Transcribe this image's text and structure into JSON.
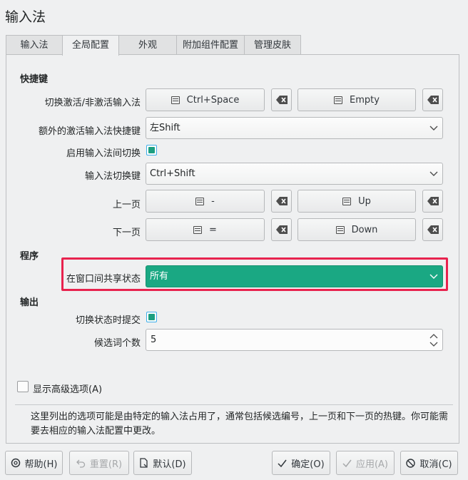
{
  "window": {
    "title": "输入法"
  },
  "tabs": [
    "输入法",
    "全局配置",
    "外观",
    "附加组件配置",
    "管理皮肤"
  ],
  "sections": {
    "hotkeys": "快捷键",
    "program": "程序",
    "output": "输出"
  },
  "hotkeys": {
    "toggle": {
      "label": "切换激活/非激活输入法",
      "key1": "Ctrl+Space",
      "key2": "Empty"
    },
    "extra": {
      "label": "额外的激活输入法快捷键",
      "value": "左Shift"
    },
    "enable_switch": {
      "label": "启用输入法间切换"
    },
    "switch_key": {
      "label": "输入法切换键",
      "value": "Ctrl+Shift"
    },
    "prev_page": {
      "label": "上一页",
      "key1": "-",
      "key2": "Up"
    },
    "next_page": {
      "label": "下一页",
      "key1": "=",
      "key2": "Down"
    }
  },
  "program": {
    "share_state": {
      "label": "在窗口间共享状态",
      "value": "所有"
    }
  },
  "output": {
    "commit_on_switch": {
      "label": "切换状态时提交"
    },
    "candidate_count": {
      "label": "候选词个数",
      "value": "5"
    }
  },
  "advanced": {
    "label": "显示高级选项(A)"
  },
  "description": "这里列出的选项可能是由特定的输入法占用了，通常包括候选编号，上一页和下一页的热键。你可能需要去相应的输入法配置中更改。",
  "buttons": {
    "help": "帮助(H)",
    "reset": "重置(R)",
    "defaults": "默认(D)",
    "ok": "确定(O)",
    "apply": "应用(A)",
    "cancel": "取消(C)"
  },
  "colors": {
    "accent": "#1aa883",
    "highlight": "#e8234e",
    "focus": "#3daee9"
  }
}
